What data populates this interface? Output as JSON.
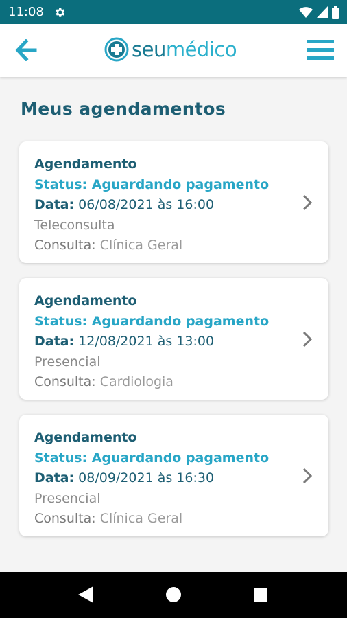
{
  "status_bar": {
    "time": "11:08",
    "background": "#0b6e7d"
  },
  "header": {
    "logo_seu": "seu",
    "logo_medico": "médico",
    "accent_color": "#2bb0cc",
    "back_icon": "arrow-left-icon",
    "menu_icon": "hamburger-menu-icon"
  },
  "page": {
    "title": "Meus agendamentos"
  },
  "appointments": [
    {
      "title": "Agendamento",
      "status": "Status: Aguardando pagamento",
      "date_label": "Data:",
      "date_value": " 06/08/2021 às 16:00",
      "type": "Teleconsulta",
      "consulta_label": "Consulta:",
      "consulta_value": " Clínica Geral"
    },
    {
      "title": "Agendamento",
      "status": "Status: Aguardando pagamento",
      "date_label": "Data:",
      "date_value": " 12/08/2021 às 13:00",
      "type": "Presencial",
      "consulta_label": "Consulta:",
      "consulta_value": " Cardiologia"
    },
    {
      "title": "Agendamento",
      "status": "Status: Aguardando pagamento",
      "date_label": "Data:",
      "date_value": " 08/09/2021 às 16:30",
      "type": "Presencial",
      "consulta_label": "Consulta:",
      "consulta_value": " Clínica Geral"
    }
  ],
  "nav_bar": {
    "buttons": [
      "back-triangle-icon",
      "home-circle-icon",
      "recents-square-icon"
    ]
  }
}
